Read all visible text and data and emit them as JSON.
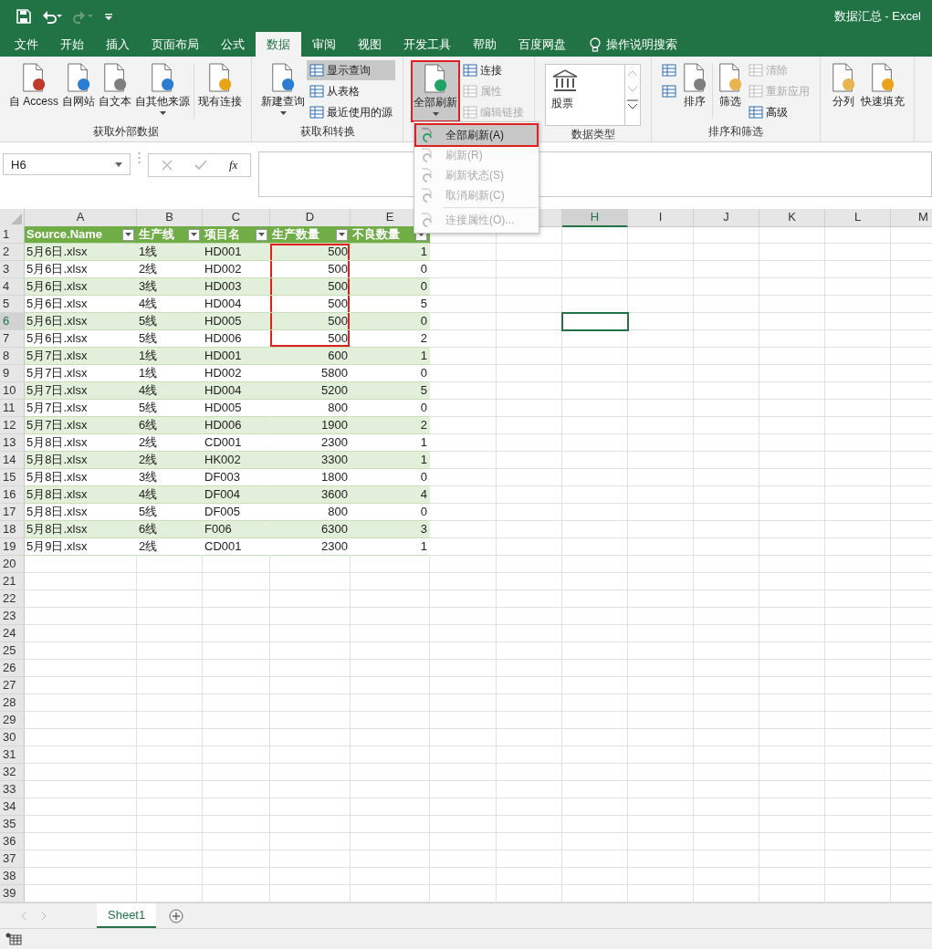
{
  "window": {
    "title": "数据汇总  -  Excel"
  },
  "tabs": [
    {
      "label": "文件",
      "selected": false
    },
    {
      "label": "开始",
      "selected": false
    },
    {
      "label": "插入",
      "selected": false
    },
    {
      "label": "页面布局",
      "selected": false
    },
    {
      "label": "公式",
      "selected": false
    },
    {
      "label": "数据",
      "selected": true
    },
    {
      "label": "审阅",
      "selected": false
    },
    {
      "label": "视图",
      "selected": false
    },
    {
      "label": "开发工具",
      "selected": false
    },
    {
      "label": "帮助",
      "selected": false
    },
    {
      "label": "百度网盘",
      "selected": false
    }
  ],
  "tell_me": {
    "placeholder": "操作说明搜索"
  },
  "ribbon_groups": [
    {
      "label": "获取外部数据",
      "items": [
        {
          "kind": "large",
          "label": "自 Access",
          "dropdown": false,
          "disabled": false,
          "marked": false
        },
        {
          "kind": "large",
          "label": "自网站",
          "dropdown": false,
          "disabled": false,
          "marked": false
        },
        {
          "kind": "large",
          "label": "自文本",
          "dropdown": false,
          "disabled": false,
          "marked": false
        },
        {
          "kind": "large",
          "label": "自其他来源",
          "dropdown": true,
          "disabled": false,
          "marked": false
        },
        {
          "kind": "separator"
        },
        {
          "kind": "large",
          "label": "现有连接",
          "dropdown": false,
          "disabled": false,
          "marked": false
        }
      ]
    },
    {
      "label": "获取和转换",
      "items": [
        {
          "kind": "large",
          "label": "新建查询",
          "dropdown": true,
          "disabled": false,
          "marked": false
        },
        {
          "kind": "stack",
          "items": [
            {
              "label": "显示查询",
              "disabled": false,
              "selected": true
            },
            {
              "label": "从表格",
              "disabled": false,
              "selected": false
            },
            {
              "label": "最近使用的源",
              "disabled": false,
              "selected": false
            }
          ]
        }
      ]
    },
    {
      "items": [
        {
          "kind": "large",
          "label": "全部刷新",
          "dropdown": true,
          "disabled": false,
          "marked": true
        },
        {
          "kind": "stack",
          "items": [
            {
              "label": "连接",
              "disabled": false,
              "selected": false
            },
            {
              "label": "属性",
              "disabled": true,
              "selected": false
            },
            {
              "label": "编辑链接",
              "disabled": true,
              "selected": false
            }
          ]
        }
      ]
    },
    {
      "label": "数据类型",
      "items": [
        {
          "kind": "gallery",
          "label": "股票"
        }
      ]
    },
    {
      "label": "排序和筛选",
      "items": [
        {
          "kind": "stack",
          "items": [
            {
              "disabled": false,
              "selected": false
            },
            {
              "disabled": false,
              "selected": false
            }
          ]
        },
        {
          "kind": "large",
          "label": "排序",
          "dropdown": false,
          "disabled": false,
          "marked": false
        },
        {
          "kind": "separator"
        },
        {
          "kind": "large",
          "label": "筛选",
          "dropdown": false,
          "disabled": false,
          "marked": false
        },
        {
          "kind": "stack",
          "items": [
            {
              "label": "清除",
              "disabled": true,
              "selected": false
            },
            {
              "label": "重新应用",
              "disabled": true,
              "selected": false
            },
            {
              "label": "高级",
              "disabled": false,
              "selected": false
            }
          ]
        }
      ]
    },
    {
      "items": [
        {
          "kind": "large",
          "label": "分列",
          "dropdown": false,
          "disabled": false,
          "marked": false
        },
        {
          "kind": "large",
          "label": "快速填充",
          "dropdown": false,
          "disabled": false,
          "marked": false
        }
      ]
    }
  ],
  "refresh_menu": [
    {
      "label": "全部刷新(A)",
      "disabled": false,
      "selected": true,
      "marked": true,
      "separator_before": false
    },
    {
      "label": "刷新(R)",
      "disabled": true,
      "selected": false,
      "marked": false,
      "separator_before": false
    },
    {
      "label": "刷新状态(S)",
      "disabled": true,
      "selected": false,
      "marked": false,
      "separator_before": false
    },
    {
      "label": "取消刷新(C)",
      "disabled": true,
      "selected": false,
      "marked": false,
      "separator_before": false
    },
    {
      "label": "连接属性(O)...",
      "disabled": true,
      "selected": false,
      "marked": false,
      "separator_before": true
    }
  ],
  "name_box": {
    "value": "H6"
  },
  "formula_bar": {
    "fx": "fx"
  },
  "column_headers": [
    {
      "label": "A",
      "selected": false
    },
    {
      "label": "B",
      "selected": false
    },
    {
      "label": "C",
      "selected": false
    },
    {
      "label": "D",
      "selected": false
    },
    {
      "label": "E",
      "selected": false
    },
    {
      "label": "H",
      "selected": true
    },
    {
      "label": "I",
      "selected": false
    },
    {
      "label": "J",
      "selected": false
    },
    {
      "label": "K",
      "selected": false
    },
    {
      "label": "L",
      "selected": false
    },
    {
      "label": "M",
      "selected": false
    }
  ],
  "row_headers": [
    {
      "label": "1",
      "selected": false
    },
    {
      "label": "2",
      "selected": false
    },
    {
      "label": "3",
      "selected": false
    },
    {
      "label": "4",
      "selected": false
    },
    {
      "label": "5",
      "selected": false
    },
    {
      "label": "6",
      "selected": true
    },
    {
      "label": "7",
      "selected": false
    },
    {
      "label": "8",
      "selected": false
    },
    {
      "label": "9",
      "selected": false
    },
    {
      "label": "10",
      "selected": false
    },
    {
      "label": "11",
      "selected": false
    },
    {
      "label": "12",
      "selected": false
    },
    {
      "label": "13",
      "selected": false
    },
    {
      "label": "14",
      "selected": false
    },
    {
      "label": "15",
      "selected": false
    },
    {
      "label": "16",
      "selected": false
    },
    {
      "label": "17",
      "selected": false
    },
    {
      "label": "18",
      "selected": false
    },
    {
      "label": "19",
      "selected": false
    },
    {
      "label": "20",
      "selected": false
    },
    {
      "label": "21",
      "selected": false
    },
    {
      "label": "22",
      "selected": false
    },
    {
      "label": "23",
      "selected": false
    },
    {
      "label": "24",
      "selected": false
    },
    {
      "label": "25",
      "selected": false
    },
    {
      "label": "26",
      "selected": false
    },
    {
      "label": "27",
      "selected": false
    },
    {
      "label": "28",
      "selected": false
    },
    {
      "label": "29",
      "selected": false
    },
    {
      "label": "30",
      "selected": false
    },
    {
      "label": "31",
      "selected": false
    },
    {
      "label": "32",
      "selected": false
    },
    {
      "label": "33",
      "selected": false
    },
    {
      "label": "34",
      "selected": false
    },
    {
      "label": "35",
      "selected": false
    },
    {
      "label": "36",
      "selected": false
    },
    {
      "label": "37",
      "selected": false
    },
    {
      "label": "38",
      "selected": false
    },
    {
      "label": "39",
      "selected": false
    }
  ],
  "table": {
    "columns": [
      "Source.Name",
      "生产线",
      "项目名",
      "生产数量",
      "不良数量"
    ],
    "rows": [
      {
        "cells": [
          "5月6日.xlsx",
          "1线",
          "HD001",
          "500",
          "1"
        ],
        "marked": true
      },
      {
        "cells": [
          "5月6日.xlsx",
          "2线",
          "HD002",
          "500",
          "0"
        ],
        "marked": true
      },
      {
        "cells": [
          "5月6日.xlsx",
          "3线",
          "HD003",
          "500",
          "0"
        ],
        "marked": true
      },
      {
        "cells": [
          "5月6日.xlsx",
          "4线",
          "HD004",
          "500",
          "5"
        ],
        "marked": true
      },
      {
        "cells": [
          "5月6日.xlsx",
          "5线",
          "HD005",
          "500",
          "0"
        ],
        "marked": true
      },
      {
        "cells": [
          "5月6日.xlsx",
          "5线",
          "HD006",
          "500",
          "2"
        ],
        "marked": true
      },
      {
        "cells": [
          "5月7日.xlsx",
          "1线",
          "HD001",
          "600",
          "1"
        ],
        "marked": false
      },
      {
        "cells": [
          "5月7日.xlsx",
          "1线",
          "HD002",
          "5800",
          "0"
        ],
        "marked": false
      },
      {
        "cells": [
          "5月7日.xlsx",
          "4线",
          "HD004",
          "5200",
          "5"
        ],
        "marked": false
      },
      {
        "cells": [
          "5月7日.xlsx",
          "5线",
          "HD005",
          "800",
          "0"
        ],
        "marked": false
      },
      {
        "cells": [
          "5月7日.xlsx",
          "6线",
          "HD006",
          "1900",
          "2"
        ],
        "marked": false
      },
      {
        "cells": [
          "5月8日.xlsx",
          "2线",
          "CD001",
          "2300",
          "1"
        ],
        "marked": false
      },
      {
        "cells": [
          "5月8日.xlsx",
          "2线",
          "HK002",
          "3300",
          "1"
        ],
        "marked": false
      },
      {
        "cells": [
          "5月8日.xlsx",
          "3线",
          "DF003",
          "1800",
          "0"
        ],
        "marked": false
      },
      {
        "cells": [
          "5月8日.xlsx",
          "4线",
          "DF004",
          "3600",
          "4"
        ],
        "marked": false
      },
      {
        "cells": [
          "5月8日.xlsx",
          "5线",
          "DF005",
          "800",
          "0"
        ],
        "marked": false
      },
      {
        "cells": [
          "5月8日.xlsx",
          "6线",
          "F006",
          "6300",
          "3"
        ],
        "marked": false
      },
      {
        "cells": [
          "5月9日.xlsx",
          "2线",
          "CD001",
          "2300",
          "1"
        ],
        "marked": false
      }
    ]
  },
  "sheet_tabs": [
    {
      "label": "Sheet1",
      "selected": true
    }
  ]
}
